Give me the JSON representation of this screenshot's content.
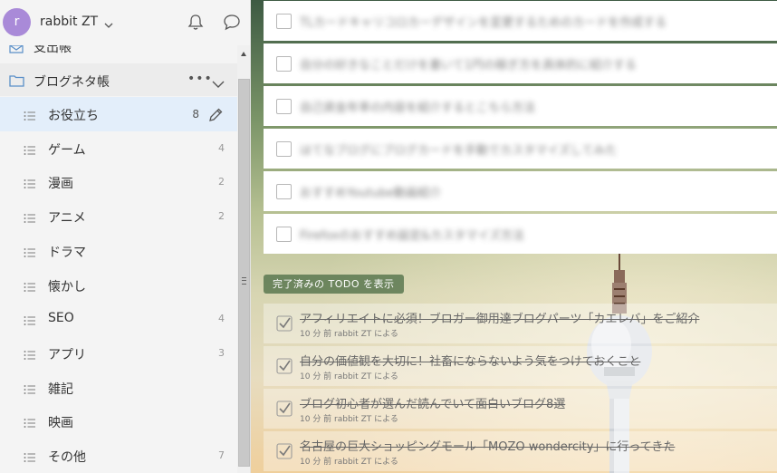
{
  "user": {
    "initial": "r",
    "name": "rabbit ZT"
  },
  "sidebar": {
    "partial_item_label": "支出帳",
    "folder": {
      "label": "ブログネタ帳",
      "more": "•••"
    },
    "lists": [
      {
        "label": "お役立ち",
        "count": "8",
        "active": true
      },
      {
        "label": "ゲーム",
        "count": "4"
      },
      {
        "label": "漫画",
        "count": "2"
      },
      {
        "label": "アニメ",
        "count": "2"
      },
      {
        "label": "ドラマ",
        "count": ""
      },
      {
        "label": "懐かし",
        "count": ""
      },
      {
        "label": "SEO",
        "count": "4"
      },
      {
        "label": "アプリ",
        "count": "3"
      },
      {
        "label": "雑記",
        "count": ""
      },
      {
        "label": "映画",
        "count": ""
      },
      {
        "label": "その他",
        "count": "7"
      }
    ]
  },
  "main": {
    "tasks": [
      {
        "title": "TLカードキャリコロカーデザインを変更するためのカードを作成する"
      },
      {
        "title": "自分の好きなことだけを書いて1円の稼ぎ方を具体的に紹介する"
      },
      {
        "title": "自己資金年率の内容を紹介するとこちら方法"
      },
      {
        "title": "はてなブログにブログカードを手動でカスタマイズしてみた"
      },
      {
        "title": "おすすめYoutube動画紹介"
      },
      {
        "title": "Firefoxのおすすめ設定&カスタマイズ方法"
      }
    ],
    "show_done_label": "完了済みの TODO を表示",
    "completed": [
      {
        "title": "アフィリエイトに必須！ブロガー御用達ブログパーツ「カエレバ」をご紹介",
        "meta": "10 分 前 rabbit ZT による"
      },
      {
        "title": "自分の価値観を大切に！社畜にならないよう気をつけておくこと",
        "meta": "10 分 前 rabbit ZT による"
      },
      {
        "title": "ブログ初心者が選んだ読んでいて面白いブログ8選",
        "meta": "10 分 前 rabbit ZT による"
      },
      {
        "title": "名古屋の巨大ショッピングモール「MOZO wondercity」に行ってきた",
        "meta": "10 分 前 rabbit ZT による"
      }
    ]
  },
  "colors": {
    "avatar": "#a98ad8",
    "active_row": "#e3eefa",
    "done_button": "#5a7850"
  },
  "icons": [
    "chevron-down-icon",
    "bell-icon",
    "chat-icon",
    "folder-icon",
    "more-icon",
    "list-icon",
    "edit-icon",
    "checkbox-checked-icon"
  ]
}
